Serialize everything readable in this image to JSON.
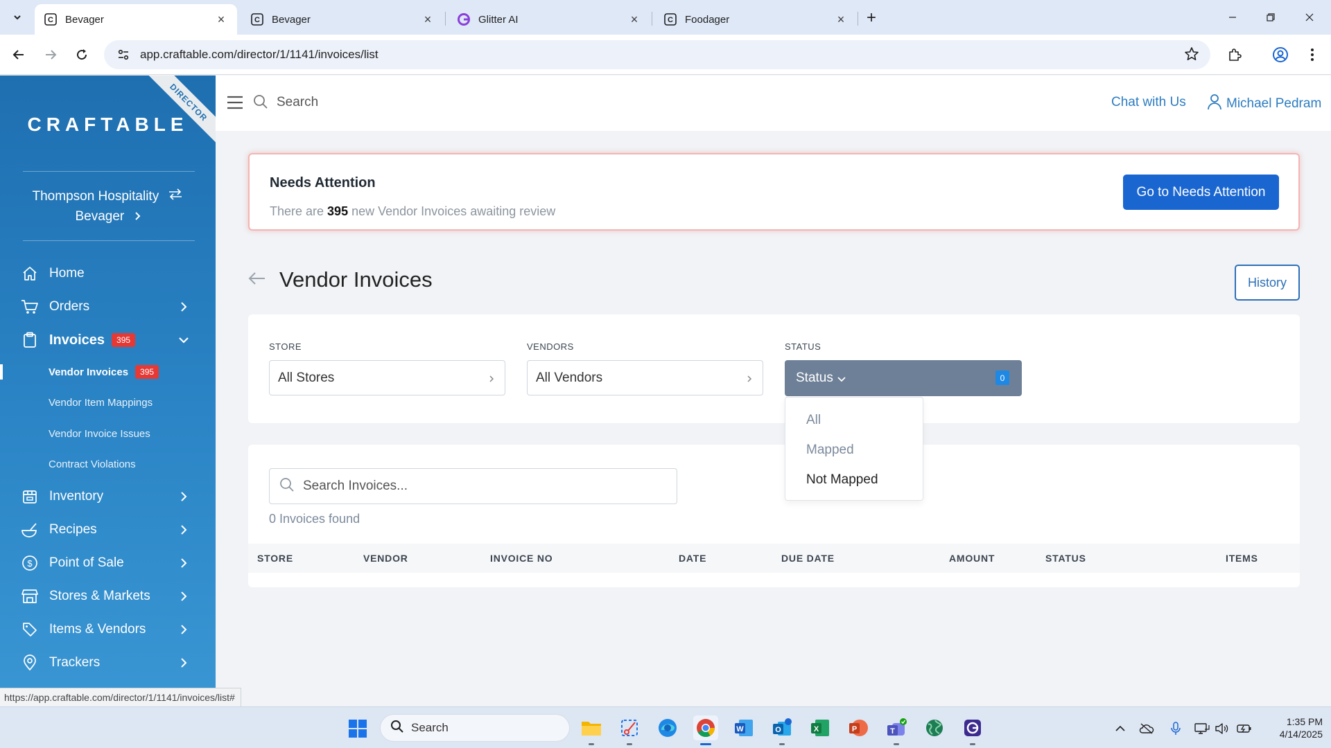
{
  "browser": {
    "tabs": [
      {
        "title": "Bevager",
        "active": true
      },
      {
        "title": "Bevager",
        "active": false
      },
      {
        "title": "Glitter AI",
        "active": false
      },
      {
        "title": "Foodager",
        "active": false
      }
    ],
    "url": "app.craftable.com/director/1/1141/invoices/list",
    "status_url": "https://app.craftable.com/director/1/1141/invoices/list#"
  },
  "sidebar": {
    "ribbon": "DIRECTOR",
    "logo": "CRAFTABLE",
    "org_name": "Thompson Hospitality",
    "store_name": "Bevager",
    "menu": [
      {
        "label": "Home",
        "icon": "home-icon"
      },
      {
        "label": "Orders",
        "icon": "cart-icon"
      },
      {
        "label": "Invoices",
        "icon": "clipboard-icon",
        "badge": "395"
      },
      {
        "label": "Inventory",
        "icon": "inventory-icon"
      },
      {
        "label": "Recipes",
        "icon": "recipes-icon"
      },
      {
        "label": "Point of Sale",
        "icon": "dollar-icon"
      },
      {
        "label": "Stores & Markets",
        "icon": "store-icon"
      },
      {
        "label": "Items & Vendors",
        "icon": "tag-icon"
      },
      {
        "label": "Trackers",
        "icon": "location-pin-icon"
      }
    ],
    "submenu": [
      {
        "label": "Vendor Invoices",
        "badge": "395"
      },
      {
        "label": "Vendor Item Mappings"
      },
      {
        "label": "Vendor Invoice Issues"
      },
      {
        "label": "Contract Violations"
      }
    ]
  },
  "topbar": {
    "search_label": "Search",
    "chat_label": "Chat with Us",
    "user_name": "Michael Pedram"
  },
  "attention": {
    "title": "Needs Attention",
    "text_prefix": "There are ",
    "count": "395",
    "text_suffix": " new Vendor Invoices awaiting review",
    "button": "Go to Needs Attention"
  },
  "page": {
    "title": "Vendor Invoices",
    "history_button": "History"
  },
  "filters": {
    "store_label": "STORE",
    "store_value": "All Stores",
    "vendors_label": "VENDORS",
    "vendors_value": "All Vendors",
    "status_label": "STATUS",
    "status_button": "Status",
    "status_count": "0",
    "status_options": [
      "All",
      "Mapped",
      "Not Mapped"
    ]
  },
  "results": {
    "search_placeholder": "Search Invoices...",
    "found_text": "0 Invoices found",
    "columns": [
      "STORE",
      "VENDOR",
      "INVOICE NO",
      "DATE",
      "DUE DATE",
      "AMOUNT",
      "STATUS",
      "ITEMS"
    ]
  },
  "taskbar": {
    "search_label": "Search",
    "time": "1:35 PM",
    "date": "4/14/2025"
  },
  "colors": {
    "sidebar_top": "#1e6fb0",
    "primary_button": "#1a66d1",
    "badge": "#e53935",
    "status_button": "#6e8097"
  }
}
